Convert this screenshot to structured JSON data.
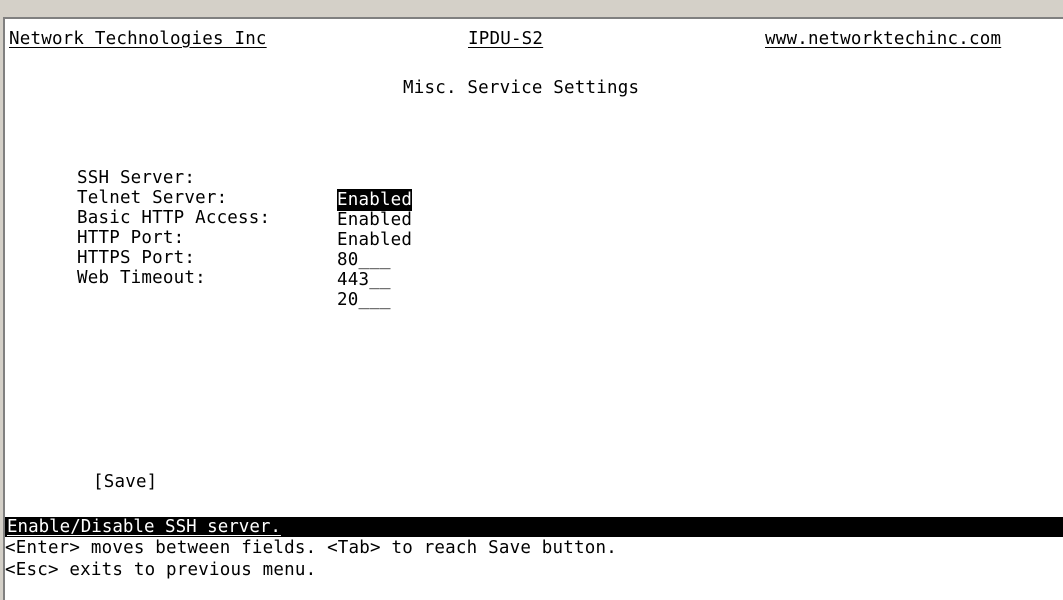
{
  "header": {
    "vendor": "Network Technologies Inc",
    "product": "IPDU-S2",
    "website": "www.networktechinc.com"
  },
  "page_title": "Misc. Service Settings",
  "fields": [
    {
      "label": "SSH Server:",
      "value": "Enabled",
      "selected": true
    },
    {
      "label": "Telnet Server:",
      "value": "Enabled",
      "selected": false
    },
    {
      "label": "Basic HTTP Access:",
      "value": "Enabled",
      "selected": false
    },
    {
      "label": "HTTP Port:",
      "value": "80___",
      "selected": false
    },
    {
      "label": "HTTPS Port:",
      "value": "443__",
      "selected": false
    },
    {
      "label": "Web Timeout:",
      "value": "20___",
      "selected": false
    }
  ],
  "save_label": "[Save]",
  "status": {
    "help": "Enable/Disable SSH server.",
    "line1": "<Enter> moves between fields. <Tab> to reach Save button.",
    "line2": "<Esc> exits to previous menu."
  }
}
